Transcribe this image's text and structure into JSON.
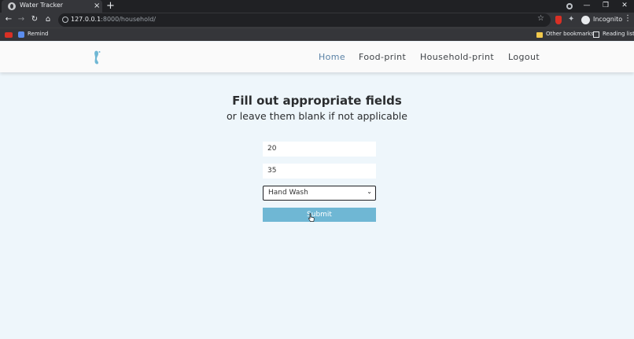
{
  "browser": {
    "tab_title": "Water Tracker",
    "tab_close": "×",
    "new_tab": "+",
    "url_host": "127.0.0.1",
    "url_path": ":8000/household/",
    "profile_label": "Incognito",
    "bookmarks": [
      {
        "label": "Remind"
      },
      {
        "label": "Other bookmarks"
      },
      {
        "label": "Reading list"
      }
    ],
    "window_buttons": [
      "—",
      "❐",
      "✕"
    ],
    "nav_glyphs": {
      "back": "←",
      "forward": "→",
      "reload": "↻",
      "home": "⌂",
      "star": "☆",
      "puzzle": "✦",
      "menu": "⋮"
    }
  },
  "site": {
    "nav": [
      {
        "label": "Home",
        "active": true
      },
      {
        "label": "Food-print",
        "active": false
      },
      {
        "label": "Household-print",
        "active": false
      },
      {
        "label": "Logout",
        "active": false
      }
    ],
    "accent_color": "#5a82a6",
    "logo_color": "#6fb7d4"
  },
  "form": {
    "title": "Fill out appropriate fields",
    "subtitle": "or leave them blank if not applicable",
    "field1_value": "20",
    "field2_value": "35",
    "select_value": "Hand Wash",
    "select_chevron": "⌄",
    "submit_label": "Submit",
    "submit_color": "#6fb7d4"
  }
}
